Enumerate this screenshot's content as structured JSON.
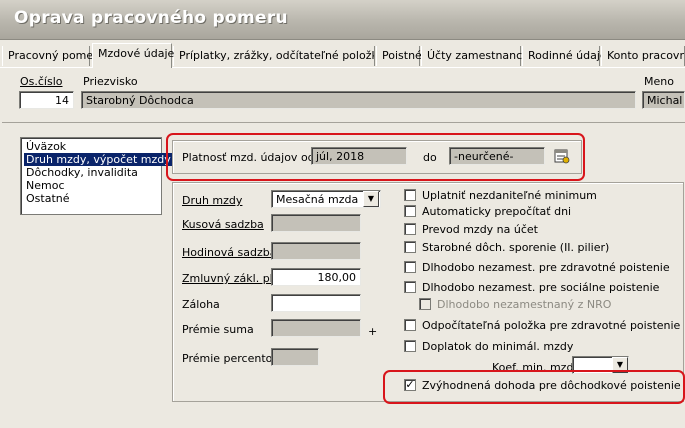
{
  "window": {
    "title": "Oprava pracovného pomeru"
  },
  "tabs": [
    {
      "label": "Pracovný pomer"
    },
    {
      "label": "Mzdové údaje"
    },
    {
      "label": "Príplatky, zrážky, odčítateľné položky ..."
    },
    {
      "label": "Poistné"
    },
    {
      "label": "Účty zamestnanca"
    },
    {
      "label": "Rodinné údaje"
    },
    {
      "label": "Konto pracovnej"
    }
  ],
  "employee": {
    "os_cislo_label": "Os.číslo",
    "os_cislo_value": "14",
    "priezvisko_label": "Priezvisko",
    "priezvisko_value": "Starobný Dôchodca",
    "meno_label": "Meno",
    "meno_value": "Michal"
  },
  "sections": [
    {
      "label": "Úväzok"
    },
    {
      "label": "Druh mzdy, výpočet mzdy",
      "selected": true
    },
    {
      "label": "Dôchodky, invalidita"
    },
    {
      "label": "Nemoc"
    },
    {
      "label": "Ostatné"
    }
  ],
  "validity": {
    "from_label": "Platnosť mzd. údajov od",
    "from_value": "júl, 2018",
    "to_label": "do",
    "to_value": "-neurčené-",
    "calendar_icon": "calendar-icon"
  },
  "wage": {
    "druh_mzdy_label": "Druh mzdy",
    "druh_mzdy_value": "Mesačná mzda",
    "kusova_sadzba_label": "Kusová sadzba",
    "hodinova_sadzba_label": "Hodinová sadzba",
    "zmluvny_plat_label": "Zmluvný zákl. plat",
    "zmluvny_plat_value": "180,00",
    "zaloha_label": "Záloha",
    "premie_suma_label": "Prémie suma",
    "plus_sign": "+",
    "premie_percento_label": "Prémie percento"
  },
  "checks": [
    {
      "label": "Uplatniť nezdaniteľné minimum",
      "checked": false
    },
    {
      "label": "Automaticky prepočítať dni",
      "checked": false
    },
    {
      "label": "Prevod mzdy na účet",
      "checked": false
    },
    {
      "label": "Starobné dôch. sporenie (II. pilier)",
      "checked": false
    },
    {
      "label": "Dlhodobo nezamest. pre zdravotné poistenie",
      "checked": false
    },
    {
      "label": "Dlhodobo nezamest. pre sociálne poistenie",
      "checked": false
    },
    {
      "label": "Dlhodobo nezamestnaný z NRO",
      "checked": false,
      "disabled": true
    },
    {
      "label": "Odpočítateľná položka pre zdravotné poistenie",
      "checked": false
    },
    {
      "label": "Doplatok do minimál. mzdy",
      "checked": false
    },
    {
      "label": "Zvýhodnená dohoda pre dôchodkové poistenie",
      "checked": true
    }
  ],
  "koef": {
    "label": "Koef. min. mzdy",
    "value": ""
  },
  "colors": {
    "highlight": "#d8151b",
    "selection": "#0a246a",
    "readonly_field": "#c4c1b8"
  }
}
